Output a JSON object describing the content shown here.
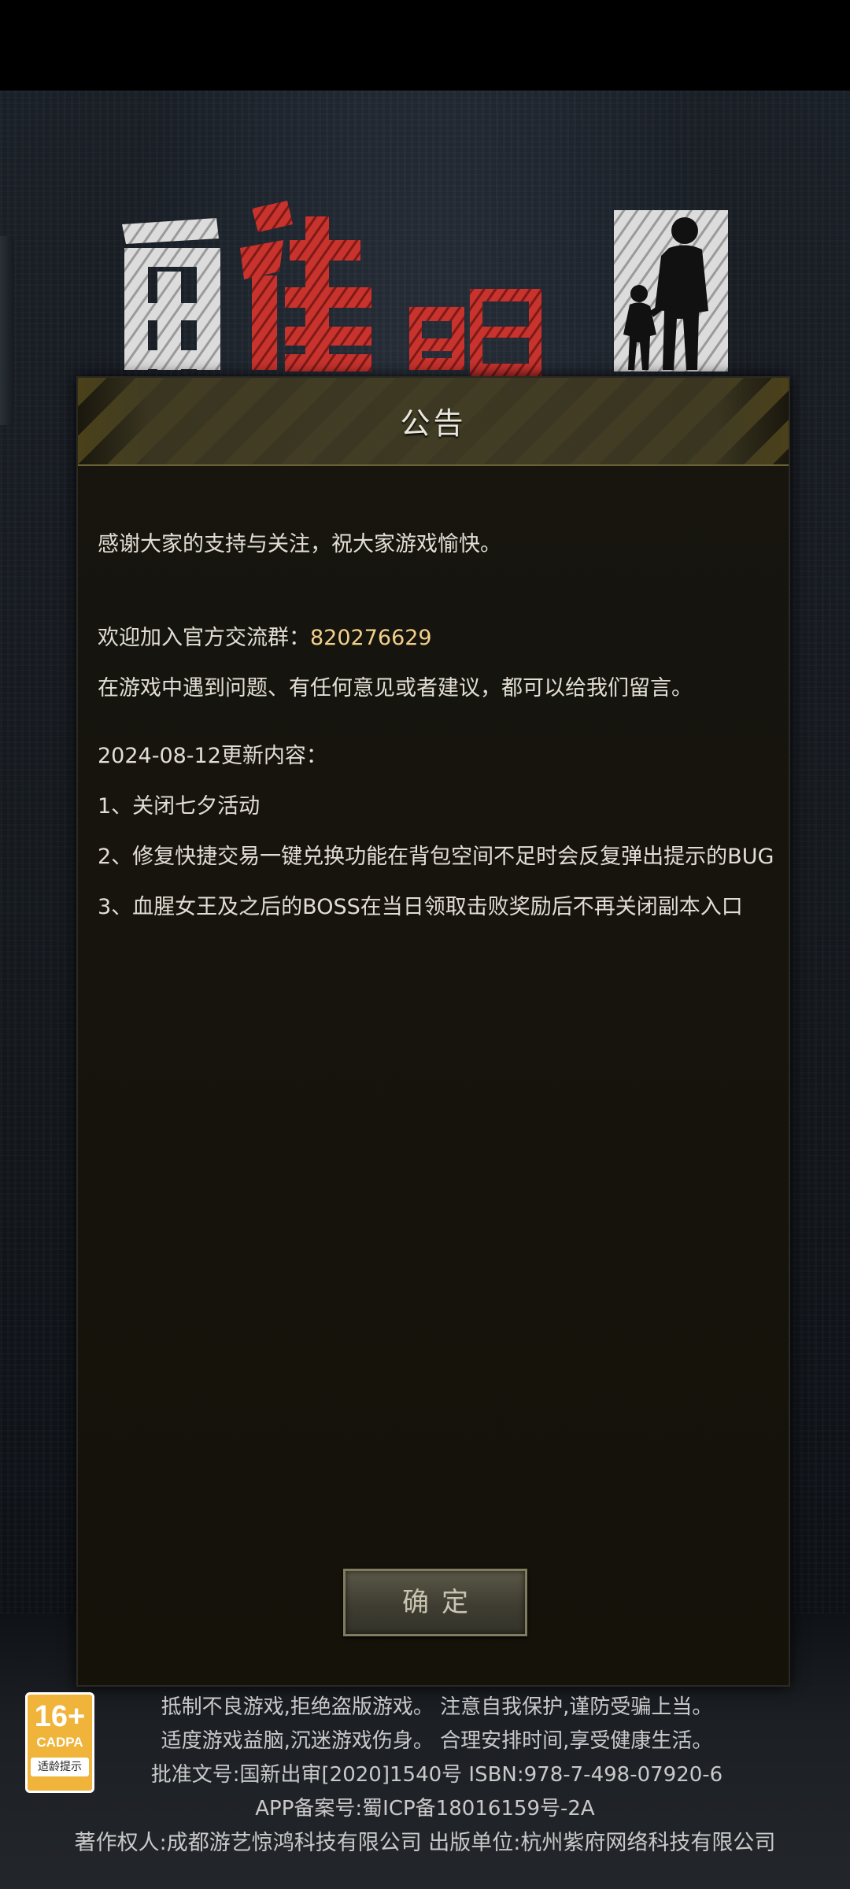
{
  "notice": {
    "title": "公告",
    "thanks": "感谢大家的支持与关注，祝大家游戏愉快。",
    "group_label": "欢迎加入官方交流群：",
    "group_number": "820276629",
    "feedback": "在游戏中遇到问题、有任何意见或者建议，都可以给我们留言。",
    "update_header": "2024-08-12更新内容：",
    "items": [
      "1、关闭七夕活动",
      "2、修复快捷交易一键兑换功能在背包空间不足时会反复弹出提示的BUG",
      "3、血腥女王及之后的BOSS在当日领取击败奖励后不再关闭副本入口"
    ],
    "confirm_label": "确定"
  },
  "age_rating": {
    "age": "16+",
    "org": "CADPA",
    "tip": "适龄提示"
  },
  "footer": {
    "line1": "抵制不良游戏,拒绝盗版游戏。 注意自我保护,谨防受骗上当。",
    "line2": "适度游戏益脑,沉迷游戏伤身。 合理安排时间,享受健康生活。",
    "line3": "批准文号:国新出审[2020]1540号    ISBN:978-7-498-07920-6",
    "line4": "APP备案号:蜀ICP备18016159号-2A",
    "line5": "著作权人:成都游艺惊鸿科技有限公司 出版单位:杭州紫府网络科技有限公司"
  },
  "colors": {
    "accent_number": "#f3d08a",
    "logo_red": "#c8332e",
    "hazard_yellow": "#d6ba3c",
    "age_badge": "#f0b43a"
  }
}
